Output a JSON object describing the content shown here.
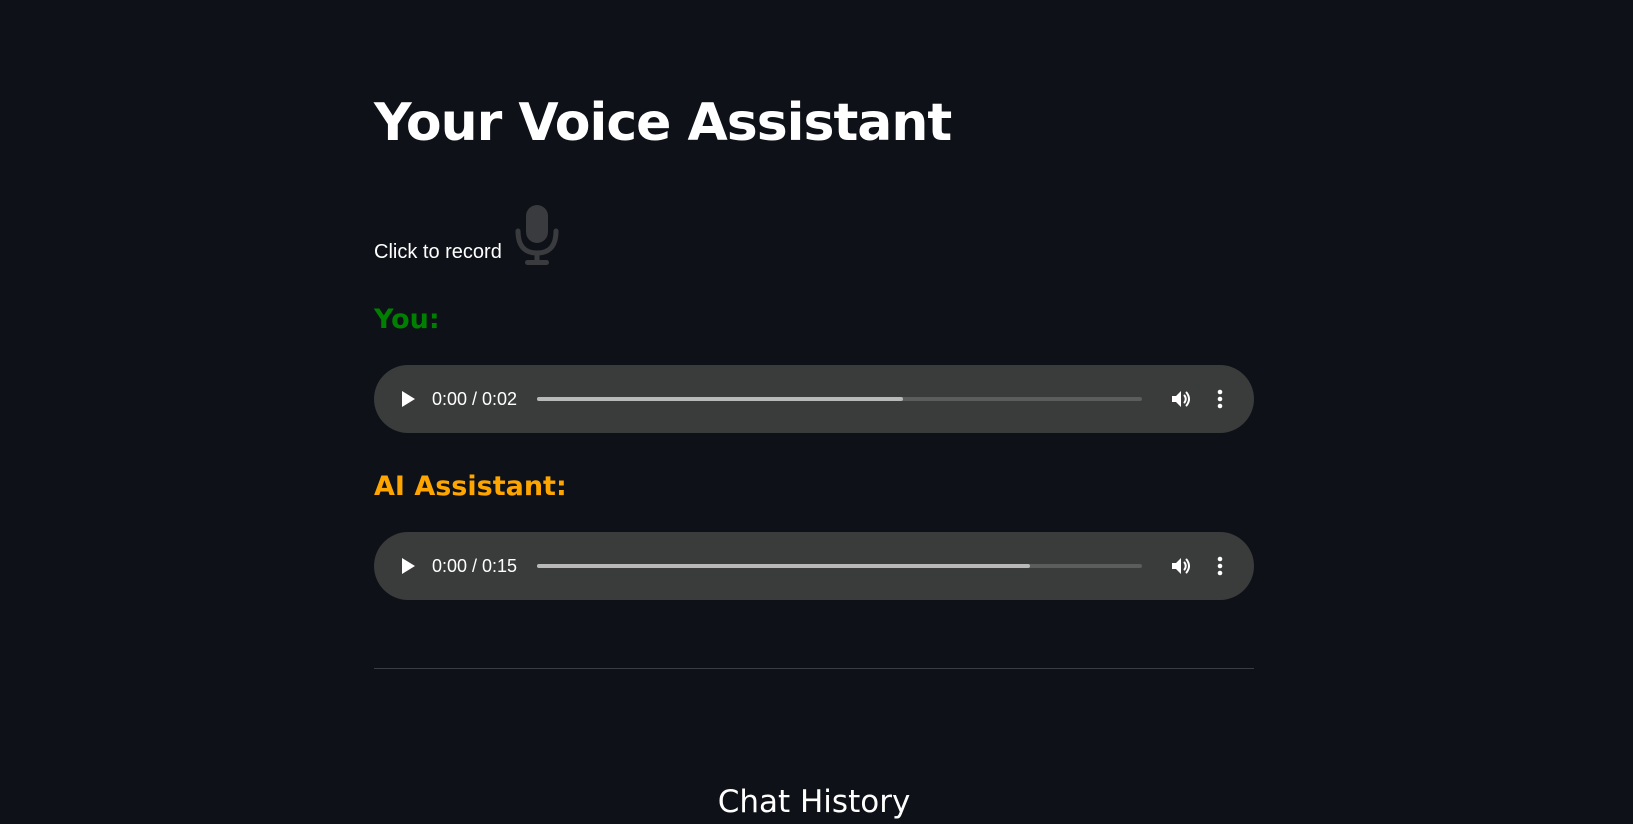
{
  "page": {
    "title": "Your Voice Assistant"
  },
  "recorder": {
    "label": "Click to record",
    "icon": "microphone-icon",
    "icon_color": "#3a3b3f"
  },
  "conversation": {
    "you": {
      "label": "You:",
      "color": "#008000",
      "player": {
        "time": "0:00 / 0:02",
        "buffered_fraction": 0.605
      }
    },
    "assistant": {
      "label": "AI Assistant:",
      "color": "#ffa500",
      "player": {
        "time": "0:00 / 0:15",
        "buffered_fraction": 0.815
      }
    }
  },
  "chat_history": {
    "heading": "Chat History"
  },
  "colors": {
    "background": "#0e1117",
    "player_background": "#3a3b3b",
    "text": "#ffffff"
  },
  "icons": {
    "play": "play-icon",
    "volume": "volume-icon",
    "more": "more-vert-icon"
  }
}
